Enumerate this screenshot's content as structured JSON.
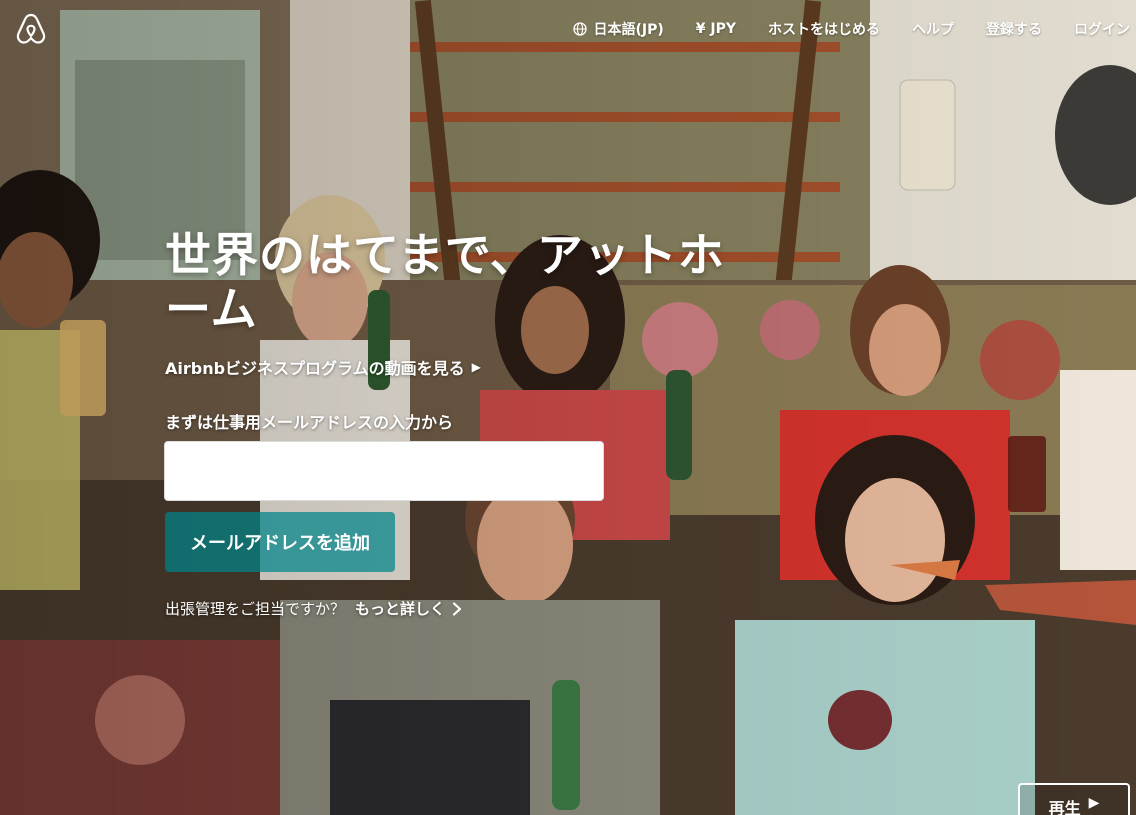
{
  "brand": {
    "logo_icon": "airbnb-logo-icon",
    "accent_color": "#008489"
  },
  "header": {
    "nav": [
      {
        "label": "日本語(JP)",
        "icon": "globe-icon"
      },
      {
        "label": "¥ JPY"
      },
      {
        "label": "ホストをはじめる"
      },
      {
        "label": "ヘルプ"
      },
      {
        "label": "登録する"
      },
      {
        "label": "ログイン"
      }
    ]
  },
  "hero": {
    "title": "世界のはてまで、アットホーム",
    "video_link_label": "Airbnbビジネスプログラムの動画を見る",
    "video_link_icon": "▶",
    "email_label": "まずは仕事用メールアドレスの入力から",
    "email_value": "",
    "email_placeholder": "",
    "submit_label": "メールアドレスを追加",
    "manager_text": "出張管理をご担当ですか？",
    "learn_more_label": "もっと詳しく"
  },
  "video_control": {
    "play_label": "再生",
    "play_icon": "▶"
  }
}
